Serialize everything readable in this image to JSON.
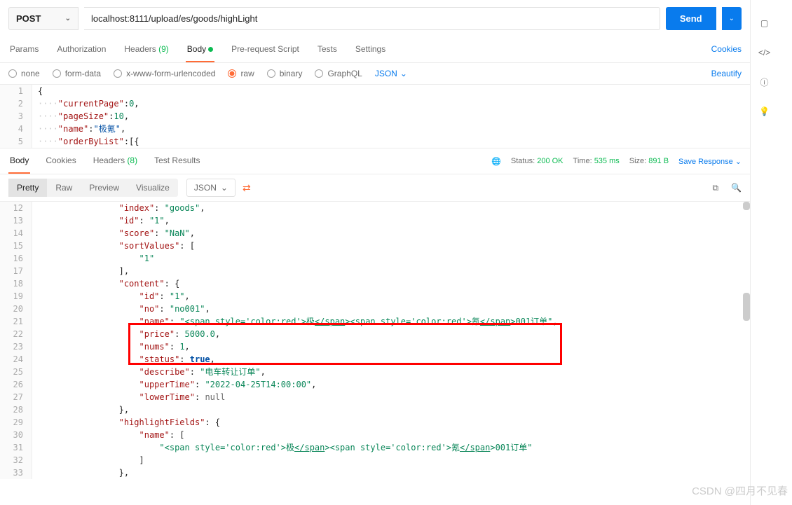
{
  "request": {
    "method": "POST",
    "url": "localhost:8111/upload/es/goods/highLight",
    "send_label": "Send"
  },
  "req_tabs": {
    "params": "Params",
    "auth": "Authorization",
    "headers": "Headers",
    "headers_count": "(9)",
    "body": "Body",
    "prerequest": "Pre-request Script",
    "tests": "Tests",
    "settings": "Settings",
    "cookies": "Cookies"
  },
  "body_types": {
    "none": "none",
    "formdata": "form-data",
    "xwww": "x-www-form-urlencoded",
    "raw": "raw",
    "binary": "binary",
    "graphql": "GraphQL",
    "json": "JSON",
    "beautify": "Beautify"
  },
  "req_editor": [
    {
      "ln": "1",
      "raw": "{"
    },
    {
      "ln": "2",
      "raw": "    \"currentPage\":0,"
    },
    {
      "ln": "3",
      "raw": "    \"pageSize\":10,"
    },
    {
      "ln": "4",
      "raw": "    \"name\":\"极氪\","
    },
    {
      "ln": "5",
      "raw": "    \"orderByList\":[{"
    }
  ],
  "resp_tabs": {
    "body": "Body",
    "cookies": "Cookies",
    "headers": "Headers",
    "headers_count": "(8)",
    "testresults": "Test Results"
  },
  "status": {
    "label": "Status:",
    "code": "200 OK",
    "time_label": "Time:",
    "time": "535 ms",
    "size_label": "Size:",
    "size": "891 B",
    "save": "Save Response"
  },
  "views": {
    "pretty": "Pretty",
    "raw": "Raw",
    "preview": "Preview",
    "visualize": "Visualize",
    "json": "JSON"
  },
  "resp_lines": [
    {
      "ln": "12",
      "html": "                <span class='rk'>\"index\"</span>: <span class='rs'>\"goods\"</span>,"
    },
    {
      "ln": "13",
      "html": "                <span class='rk'>\"id\"</span>: <span class='rs'>\"1\"</span>,"
    },
    {
      "ln": "14",
      "html": "                <span class='rk'>\"score\"</span>: <span class='rs'>\"NaN\"</span>,"
    },
    {
      "ln": "15",
      "html": "                <span class='rk'>\"sortValues\"</span>: ["
    },
    {
      "ln": "16",
      "html": "                    <span class='rs'>\"1\"</span>"
    },
    {
      "ln": "17",
      "html": "                ],"
    },
    {
      "ln": "18",
      "html": "                <span class='rk'>\"content\"</span>: {"
    },
    {
      "ln": "19",
      "html": "                    <span class='rk'>\"id\"</span>: <span class='rs'>\"1\"</span>,"
    },
    {
      "ln": "20",
      "html": "                    <span class='rk'>\"no\"</span>: <span class='rs'>\"no001\"</span>,"
    },
    {
      "ln": "21",
      "html": "                    <span class='rk'>\"name\"</span>: <span class='rs'>\"&lt;span style='color:red'&gt;极<span class='underline'>&lt;/span</span>&gt;&lt;span style='color:red'&gt;氪<span class='underline'>&lt;/span</span>&gt;001订单\"</span>,"
    },
    {
      "ln": "22",
      "html": "                    <span class='rk'>\"price\"</span>: <span class='rn'>5000.0</span>,"
    },
    {
      "ln": "23",
      "html": "                    <span class='rk'>\"nums\"</span>: <span class='rn'>1</span>,"
    },
    {
      "ln": "24",
      "html": "                    <span class='rk'>\"status\"</span>: <span class='rb'>true</span>,"
    },
    {
      "ln": "25",
      "html": "                    <span class='rk'>\"describe\"</span>: <span class='rs'>\"电车转让订单\"</span>,"
    },
    {
      "ln": "26",
      "html": "                    <span class='rk'>\"upperTime\"</span>: <span class='rs'>\"2022-04-25T14:00:00\"</span>,"
    },
    {
      "ln": "27",
      "html": "                    <span class='rk'>\"lowerTime\"</span>: <span class='rnull'>null</span>"
    },
    {
      "ln": "28",
      "html": "                },"
    },
    {
      "ln": "29",
      "html": "                <span class='rk'>\"highlightFields\"</span>: {"
    },
    {
      "ln": "30",
      "html": "                    <span class='rk'>\"name\"</span>: ["
    },
    {
      "ln": "31",
      "html": "                        <span class='rs'>\"&lt;span style='color:red'&gt;极<span class='underline'>&lt;/span</span>&gt;&lt;span style='color:red'&gt;氪<span class='underline'>&lt;/span</span>&gt;001订单\"</span>"
    },
    {
      "ln": "32",
      "html": "                    ]"
    },
    {
      "ln": "33",
      "html": "                },"
    }
  ],
  "watermark": "CSDN @四月不见春"
}
